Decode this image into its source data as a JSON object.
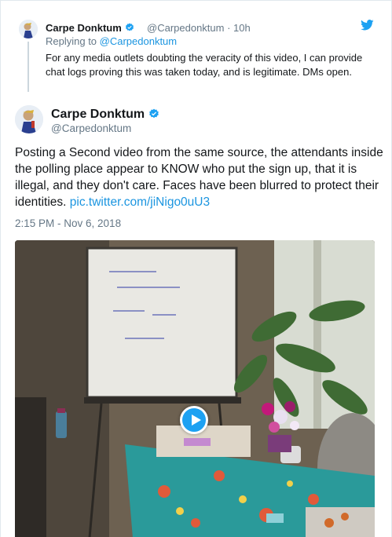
{
  "reply": {
    "name": "Carpe Donktum",
    "handle_time": "@Carpedonktum · 10h",
    "replying_prefix": "Replying to ",
    "replying_handle": "@Carpedonktum",
    "text": "For any media outlets doubting the veracity of this video, I can provide chat logs proving this was taken today, and is legitimate. DMs open."
  },
  "tweet": {
    "name": "Carpe Donktum",
    "handle": "@Carpedonktum",
    "text": "Posting a Second video from the same source, the attendants inside the polling place appear to KNOW who put the sign up, that it is illegal, and they don't care. Faces have been blurred to protect their identities.",
    "link": "pic.twitter.com/jiNigo0uU3",
    "timestamp": "2:15 PM - Nov 6, 2018"
  },
  "icons": {
    "verified": "verified-badge-icon",
    "brand": "twitter-bird-icon",
    "play": "play-icon"
  },
  "colors": {
    "accent": "#1da1f2",
    "link": "#1b95e0",
    "muted": "#657786"
  }
}
